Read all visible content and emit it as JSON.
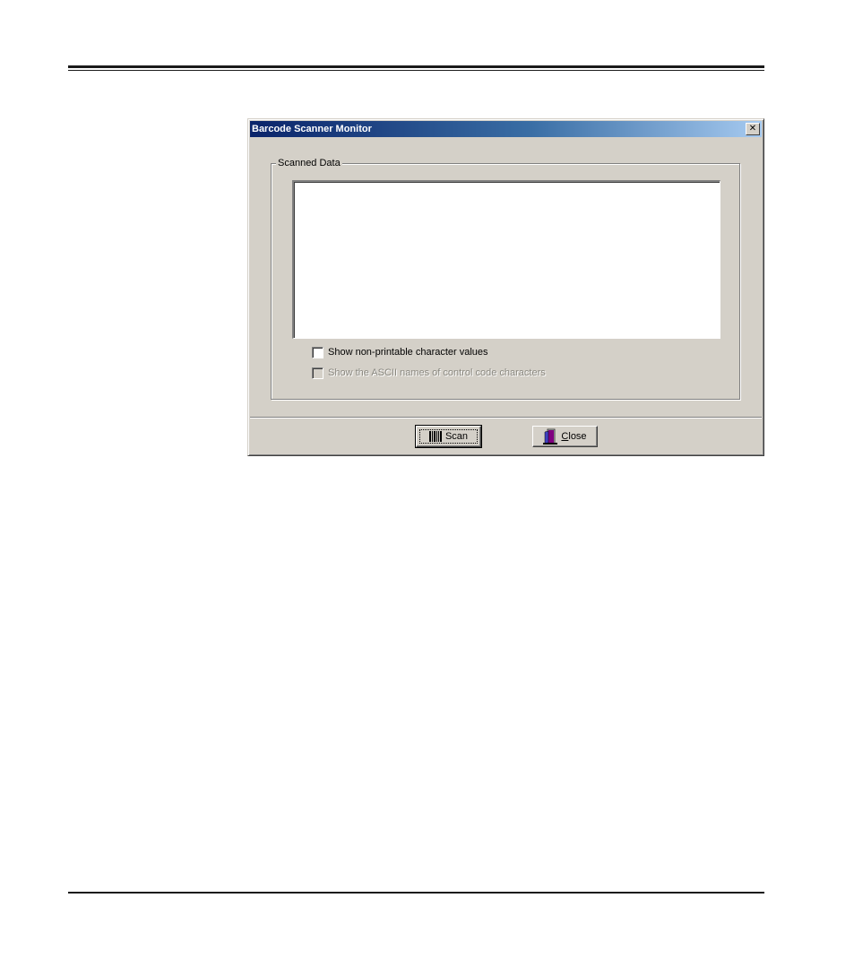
{
  "window": {
    "title": "Barcode Scanner Monitor",
    "close_glyph": "✕"
  },
  "group": {
    "label": "Scanned Data",
    "scanned_text": ""
  },
  "options": {
    "show_nonprintable": {
      "label": "Show non-printable character values",
      "checked": false,
      "enabled": true
    },
    "show_ascii_names": {
      "label": "Show the ASCII names of control code characters",
      "checked": false,
      "enabled": false
    }
  },
  "buttons": {
    "scan": {
      "label": "Scan",
      "icon": "barcode-icon"
    },
    "close": {
      "label_prefix": "",
      "label_accel": "C",
      "label_rest": "lose",
      "icon": "door-exit-icon"
    }
  },
  "colors": {
    "title_start": "#0a246a",
    "title_end": "#a6caf0",
    "face": "#d4d0c8"
  }
}
